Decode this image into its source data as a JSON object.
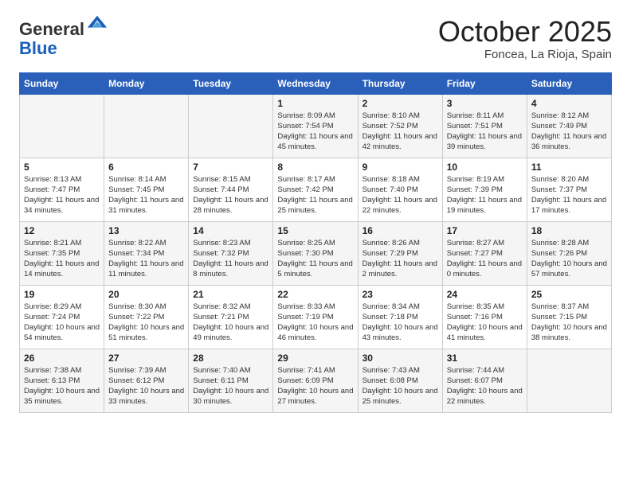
{
  "logo": {
    "general": "General",
    "blue": "Blue"
  },
  "header": {
    "month": "October 2025",
    "location": "Foncea, La Rioja, Spain"
  },
  "days_of_week": [
    "Sunday",
    "Monday",
    "Tuesday",
    "Wednesday",
    "Thursday",
    "Friday",
    "Saturday"
  ],
  "weeks": [
    [
      {
        "day": "",
        "info": ""
      },
      {
        "day": "",
        "info": ""
      },
      {
        "day": "",
        "info": ""
      },
      {
        "day": "1",
        "info": "Sunrise: 8:09 AM\nSunset: 7:54 PM\nDaylight: 11 hours and 45 minutes."
      },
      {
        "day": "2",
        "info": "Sunrise: 8:10 AM\nSunset: 7:52 PM\nDaylight: 11 hours and 42 minutes."
      },
      {
        "day": "3",
        "info": "Sunrise: 8:11 AM\nSunset: 7:51 PM\nDaylight: 11 hours and 39 minutes."
      },
      {
        "day": "4",
        "info": "Sunrise: 8:12 AM\nSunset: 7:49 PM\nDaylight: 11 hours and 36 minutes."
      }
    ],
    [
      {
        "day": "5",
        "info": "Sunrise: 8:13 AM\nSunset: 7:47 PM\nDaylight: 11 hours and 34 minutes."
      },
      {
        "day": "6",
        "info": "Sunrise: 8:14 AM\nSunset: 7:45 PM\nDaylight: 11 hours and 31 minutes."
      },
      {
        "day": "7",
        "info": "Sunrise: 8:15 AM\nSunset: 7:44 PM\nDaylight: 11 hours and 28 minutes."
      },
      {
        "day": "8",
        "info": "Sunrise: 8:17 AM\nSunset: 7:42 PM\nDaylight: 11 hours and 25 minutes."
      },
      {
        "day": "9",
        "info": "Sunrise: 8:18 AM\nSunset: 7:40 PM\nDaylight: 11 hours and 22 minutes."
      },
      {
        "day": "10",
        "info": "Sunrise: 8:19 AM\nSunset: 7:39 PM\nDaylight: 11 hours and 19 minutes."
      },
      {
        "day": "11",
        "info": "Sunrise: 8:20 AM\nSunset: 7:37 PM\nDaylight: 11 hours and 17 minutes."
      }
    ],
    [
      {
        "day": "12",
        "info": "Sunrise: 8:21 AM\nSunset: 7:35 PM\nDaylight: 11 hours and 14 minutes."
      },
      {
        "day": "13",
        "info": "Sunrise: 8:22 AM\nSunset: 7:34 PM\nDaylight: 11 hours and 11 minutes."
      },
      {
        "day": "14",
        "info": "Sunrise: 8:23 AM\nSunset: 7:32 PM\nDaylight: 11 hours and 8 minutes."
      },
      {
        "day": "15",
        "info": "Sunrise: 8:25 AM\nSunset: 7:30 PM\nDaylight: 11 hours and 5 minutes."
      },
      {
        "day": "16",
        "info": "Sunrise: 8:26 AM\nSunset: 7:29 PM\nDaylight: 11 hours and 2 minutes."
      },
      {
        "day": "17",
        "info": "Sunrise: 8:27 AM\nSunset: 7:27 PM\nDaylight: 11 hours and 0 minutes."
      },
      {
        "day": "18",
        "info": "Sunrise: 8:28 AM\nSunset: 7:26 PM\nDaylight: 10 hours and 57 minutes."
      }
    ],
    [
      {
        "day": "19",
        "info": "Sunrise: 8:29 AM\nSunset: 7:24 PM\nDaylight: 10 hours and 54 minutes."
      },
      {
        "day": "20",
        "info": "Sunrise: 8:30 AM\nSunset: 7:22 PM\nDaylight: 10 hours and 51 minutes."
      },
      {
        "day": "21",
        "info": "Sunrise: 8:32 AM\nSunset: 7:21 PM\nDaylight: 10 hours and 49 minutes."
      },
      {
        "day": "22",
        "info": "Sunrise: 8:33 AM\nSunset: 7:19 PM\nDaylight: 10 hours and 46 minutes."
      },
      {
        "day": "23",
        "info": "Sunrise: 8:34 AM\nSunset: 7:18 PM\nDaylight: 10 hours and 43 minutes."
      },
      {
        "day": "24",
        "info": "Sunrise: 8:35 AM\nSunset: 7:16 PM\nDaylight: 10 hours and 41 minutes."
      },
      {
        "day": "25",
        "info": "Sunrise: 8:37 AM\nSunset: 7:15 PM\nDaylight: 10 hours and 38 minutes."
      }
    ],
    [
      {
        "day": "26",
        "info": "Sunrise: 7:38 AM\nSunset: 6:13 PM\nDaylight: 10 hours and 35 minutes."
      },
      {
        "day": "27",
        "info": "Sunrise: 7:39 AM\nSunset: 6:12 PM\nDaylight: 10 hours and 33 minutes."
      },
      {
        "day": "28",
        "info": "Sunrise: 7:40 AM\nSunset: 6:11 PM\nDaylight: 10 hours and 30 minutes."
      },
      {
        "day": "29",
        "info": "Sunrise: 7:41 AM\nSunset: 6:09 PM\nDaylight: 10 hours and 27 minutes."
      },
      {
        "day": "30",
        "info": "Sunrise: 7:43 AM\nSunset: 6:08 PM\nDaylight: 10 hours and 25 minutes."
      },
      {
        "day": "31",
        "info": "Sunrise: 7:44 AM\nSunset: 6:07 PM\nDaylight: 10 hours and 22 minutes."
      },
      {
        "day": "",
        "info": ""
      }
    ]
  ]
}
